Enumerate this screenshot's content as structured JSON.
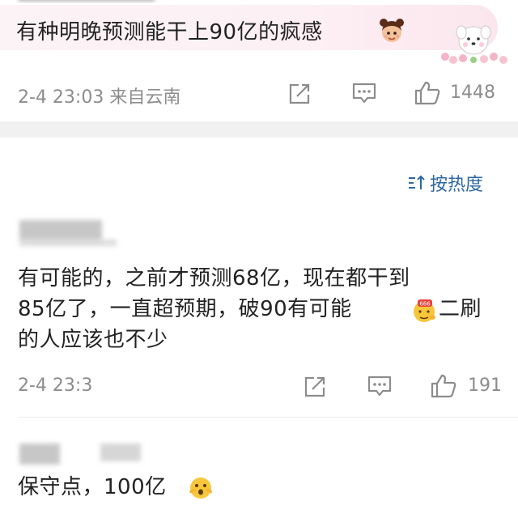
{
  "top_comment": {
    "text": "有种明晚预测能干上90亿的疯感",
    "meta": "2-4 23:03 来自云南",
    "likes": "1448"
  },
  "sort": {
    "label": "按热度"
  },
  "reply_1": {
    "lines": [
      "有可能的，之前才预测68亿，现在都干到",
      "85亿了，一直超预期，破90有可能",
      "二刷",
      "的人应该也不少"
    ],
    "meta": "2-4 23:3",
    "likes": "191"
  },
  "reply_2": {
    "text": "保守点，100亿"
  },
  "icons": {
    "share": "share-icon",
    "comment": "comment-icon",
    "like": "thumbs-up-icon",
    "sort": "sort-icon"
  },
  "colors": {
    "link_blue": "#2f67a6",
    "meta_gray": "#8c8c8c",
    "band_gray": "#f1f1f1"
  }
}
